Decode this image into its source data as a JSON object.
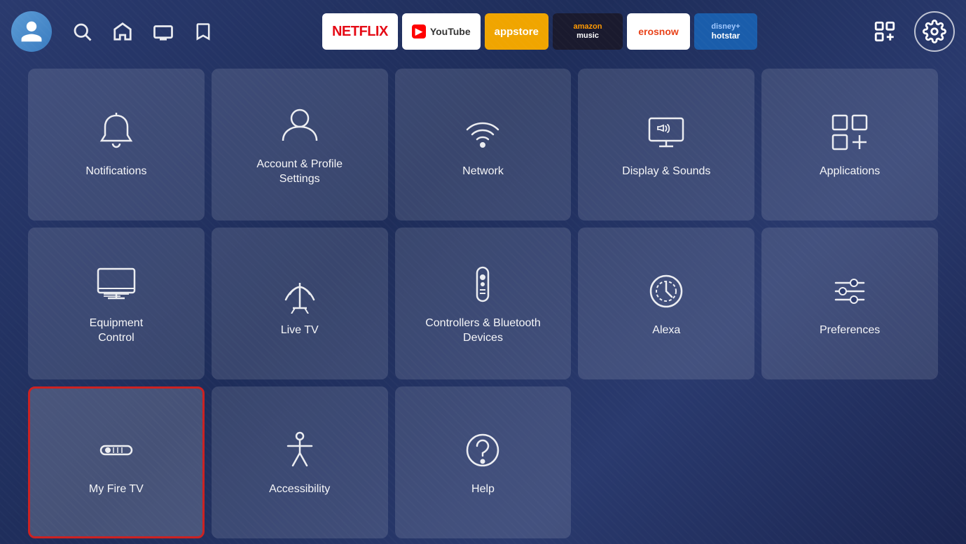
{
  "topbar": {
    "apps": [
      {
        "id": "netflix",
        "label": "NETFLIX"
      },
      {
        "id": "youtube",
        "label": "YouTube"
      },
      {
        "id": "appstore",
        "label": "appstore"
      },
      {
        "id": "amazonmusic",
        "label_top": "amazon",
        "label_bot": "music"
      },
      {
        "id": "erosnow",
        "label": "erosnow"
      },
      {
        "id": "hotstar",
        "label_top": "disney+",
        "label_bot": "hotstar"
      }
    ]
  },
  "grid": {
    "tiles": [
      {
        "id": "notifications",
        "label": "Notifications",
        "icon": "bell"
      },
      {
        "id": "account-profile",
        "label": "Account & Profile\nSettings",
        "icon": "person"
      },
      {
        "id": "network",
        "label": "Network",
        "icon": "wifi"
      },
      {
        "id": "display-sounds",
        "label": "Display & Sounds",
        "icon": "display"
      },
      {
        "id": "applications",
        "label": "Applications",
        "icon": "apps"
      },
      {
        "id": "equipment-control",
        "label": "Equipment\nControl",
        "icon": "monitor"
      },
      {
        "id": "live-tv",
        "label": "Live TV",
        "icon": "antenna"
      },
      {
        "id": "controllers-bluetooth",
        "label": "Controllers & Bluetooth\nDevices",
        "icon": "remote"
      },
      {
        "id": "alexa",
        "label": "Alexa",
        "icon": "alexa"
      },
      {
        "id": "preferences",
        "label": "Preferences",
        "icon": "sliders"
      },
      {
        "id": "my-fire-tv",
        "label": "My Fire TV",
        "icon": "firetv",
        "selected": true
      },
      {
        "id": "accessibility",
        "label": "Accessibility",
        "icon": "accessibility"
      },
      {
        "id": "help",
        "label": "Help",
        "icon": "help"
      }
    ]
  }
}
